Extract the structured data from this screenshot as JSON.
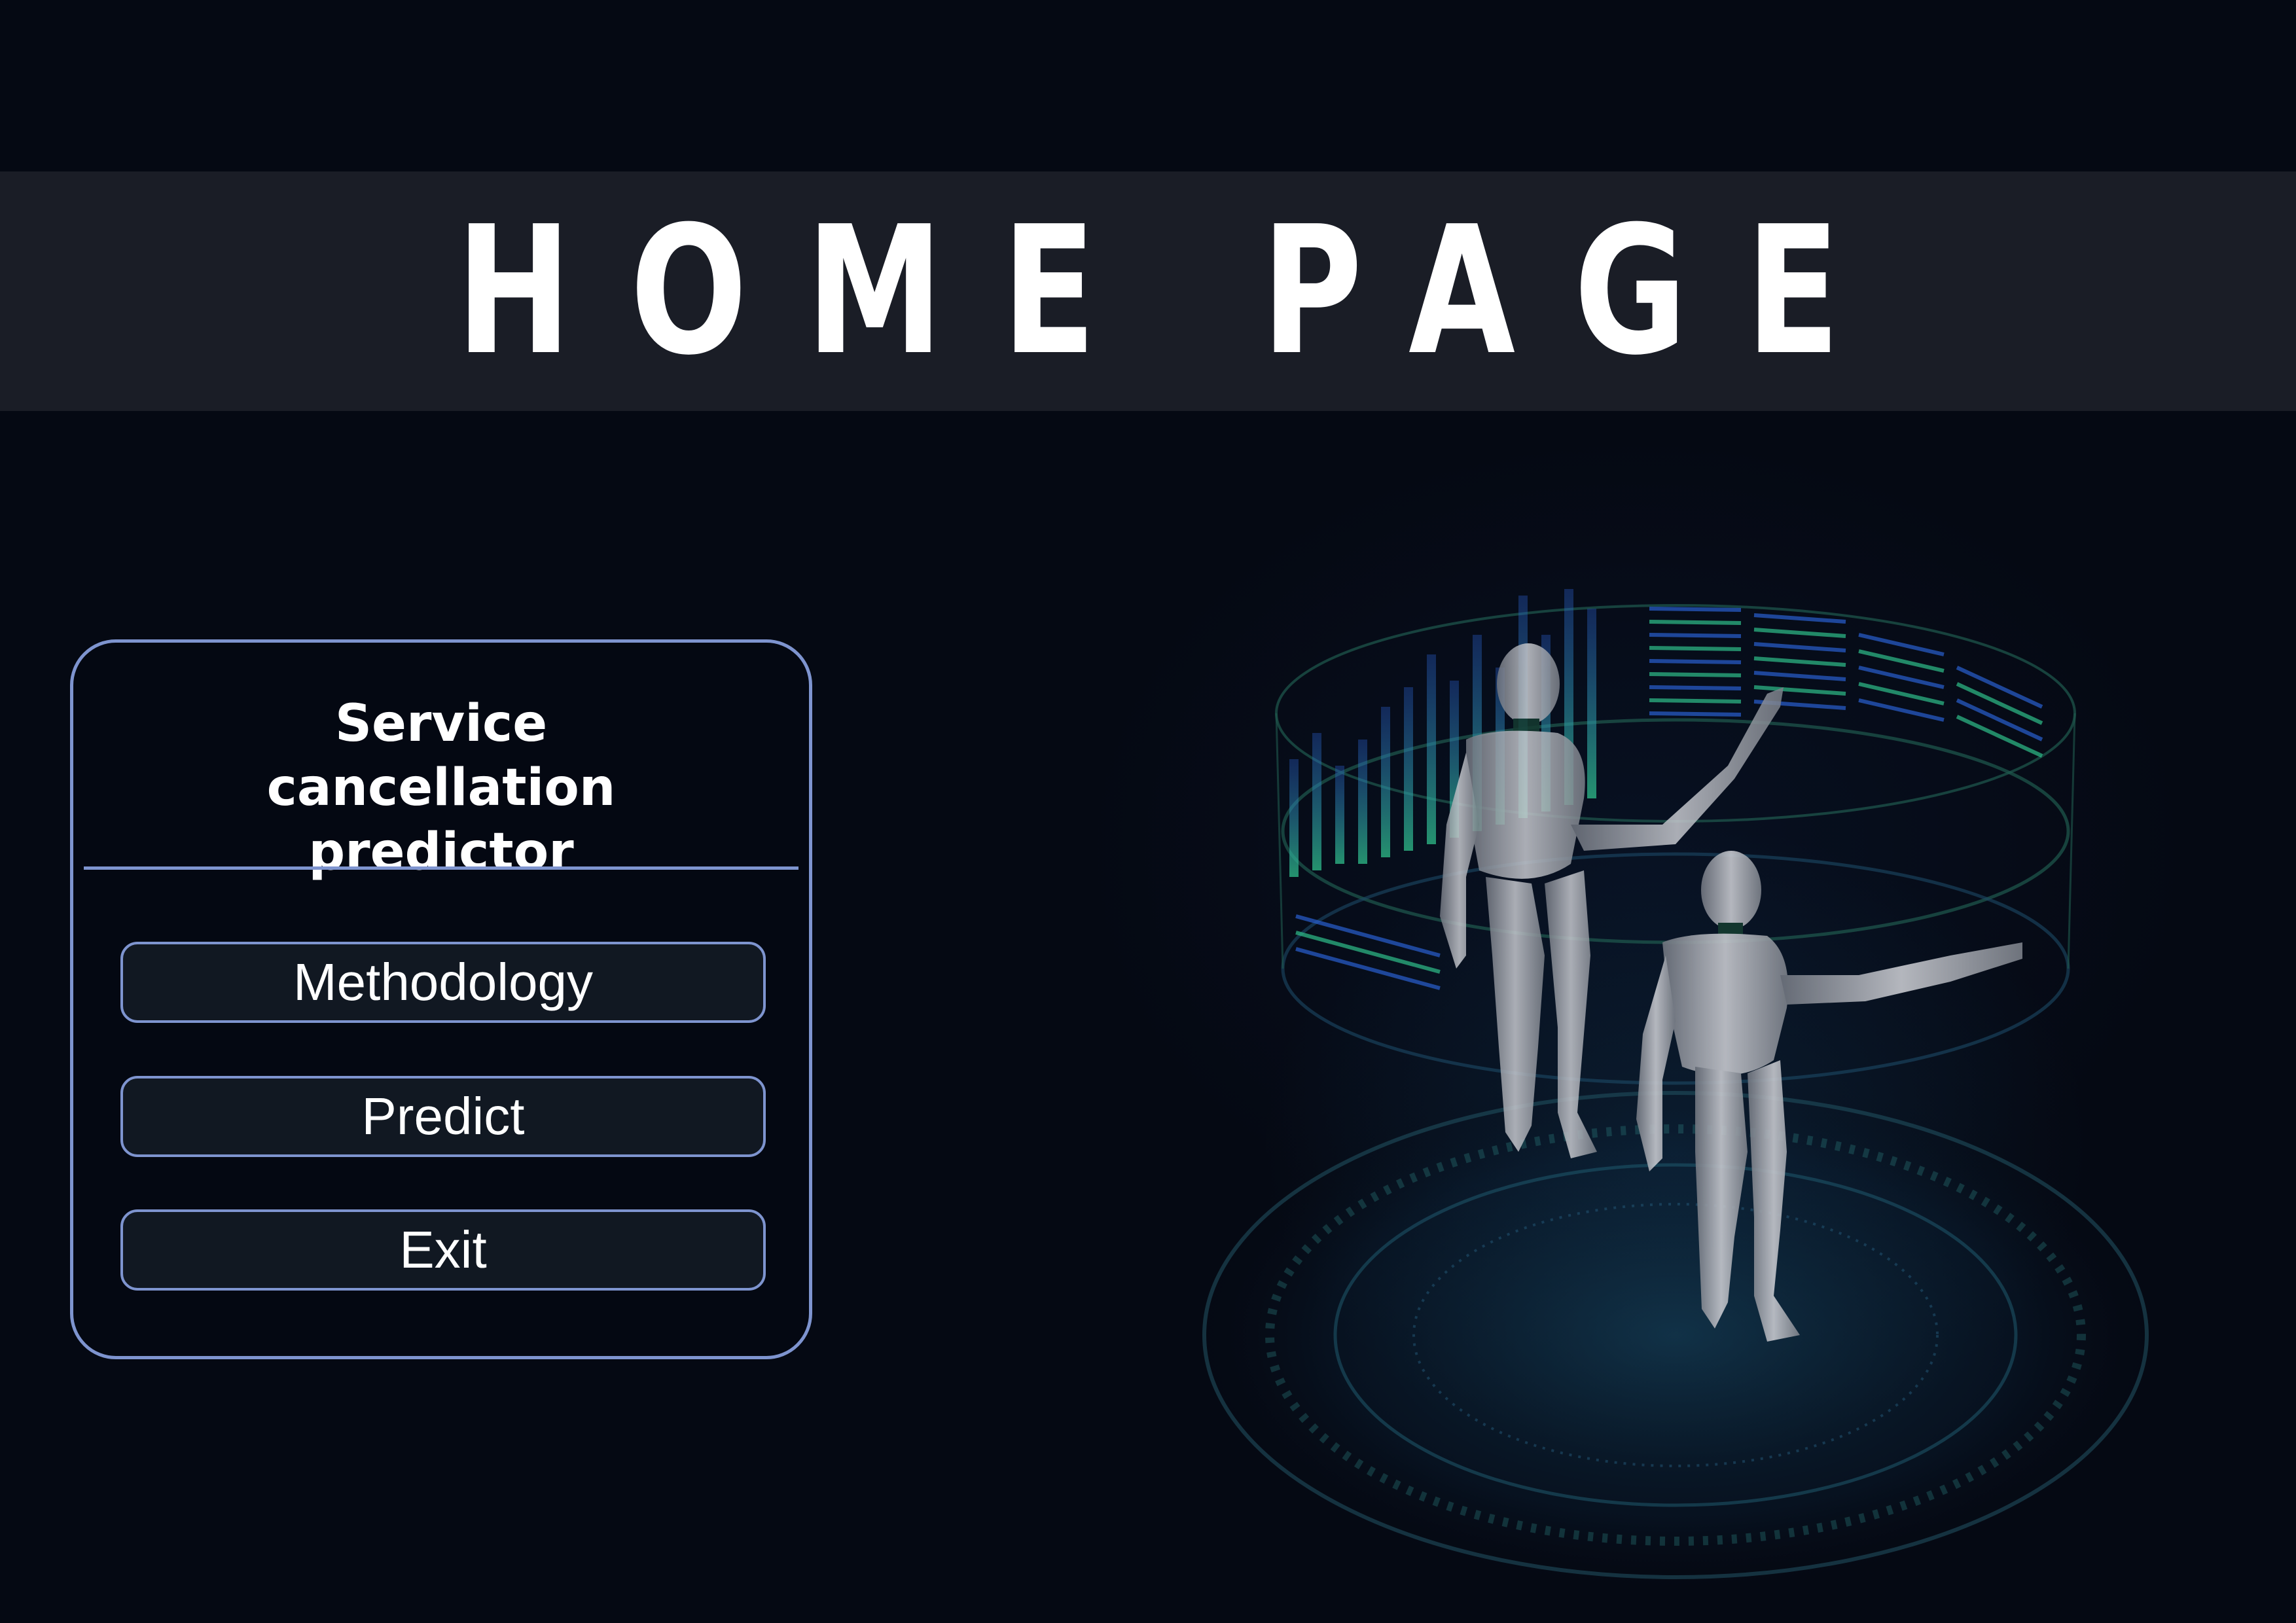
{
  "header": {
    "title": "HOME PAGE"
  },
  "panel": {
    "title": "Service cancellation predictor",
    "buttons": [
      {
        "label": "Methodology"
      },
      {
        "label": "Predict"
      },
      {
        "label": "Exit"
      }
    ]
  },
  "colors": {
    "background": "#050913",
    "header_band": "#1a1d26",
    "panel_border": "#7e94cf",
    "button_fill": "#111822",
    "accent_green": "#2fbf8a",
    "accent_blue": "#2a5fd0"
  },
  "illustration": {
    "icon": "robots-hologram-illustration"
  }
}
